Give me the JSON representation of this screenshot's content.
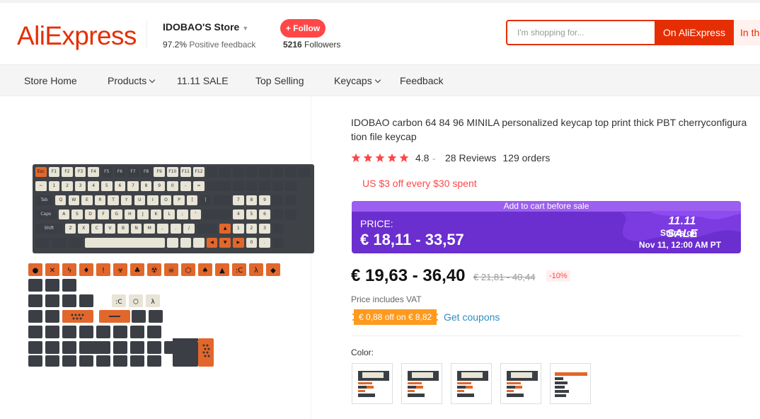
{
  "header": {
    "logo": "AliExpress",
    "store_name": "IDOBAO'S Store",
    "feedback_pct": "97.2%",
    "feedback_label": "Positive feedback",
    "follow_label": "+ Follow",
    "followers_count": "5216",
    "followers_label": "Followers",
    "search_placeholder": "I'm shopping for...",
    "search_aliexpress": "On AliExpress",
    "search_store": "In th"
  },
  "nav": {
    "items": [
      {
        "label": "Store Home",
        "dropdown": false
      },
      {
        "label": "Products",
        "dropdown": true
      },
      {
        "label": "11.11 SALE",
        "dropdown": false
      },
      {
        "label": "Top Selling",
        "dropdown": false
      },
      {
        "label": "Keycaps",
        "dropdown": true
      },
      {
        "label": "Feedback",
        "dropdown": false
      }
    ]
  },
  "product": {
    "title": "IDOBAO carbon 64 84 96 MINILA personalized keycap top print thick PBT cherryconfiguration file keycap",
    "rating": "4.8",
    "stars": 5,
    "reviews": "28 Reviews",
    "orders": "129 orders",
    "promo": "US $3 off every $30 spent",
    "sale_banner": {
      "header": "Add to cart before sale",
      "price_label": "PRICE:",
      "price_range": "€ 18,11 - 33,57",
      "event": "11.11 SALE",
      "starts_on": "Starts on",
      "date": "Nov 11, 12:00 AM PT"
    },
    "price": "€ 19,63 - 36,40",
    "old_price": "€ 21,81 - 40,44",
    "discount": "-10%",
    "vat_note": "Price includes VAT",
    "coupon": "€ 0,88 off on € 8,82",
    "get_coupons": "Get coupons",
    "color_label": "Color:",
    "color_options": [
      "variant-1",
      "variant-2",
      "variant-3",
      "variant-4",
      "variant-5"
    ]
  },
  "colors": {
    "brand": "#e62e04",
    "follow": "#ff4747",
    "sale_purple": "#6b2ecf",
    "sale_header": "#9c5ff0",
    "coupon": "#ff9a1f",
    "link": "#2e8cc4",
    "star": "#ff4747",
    "key_light": "#e8e4d6",
    "key_dark": "#3b3f45",
    "key_orange": "#e2672c"
  }
}
